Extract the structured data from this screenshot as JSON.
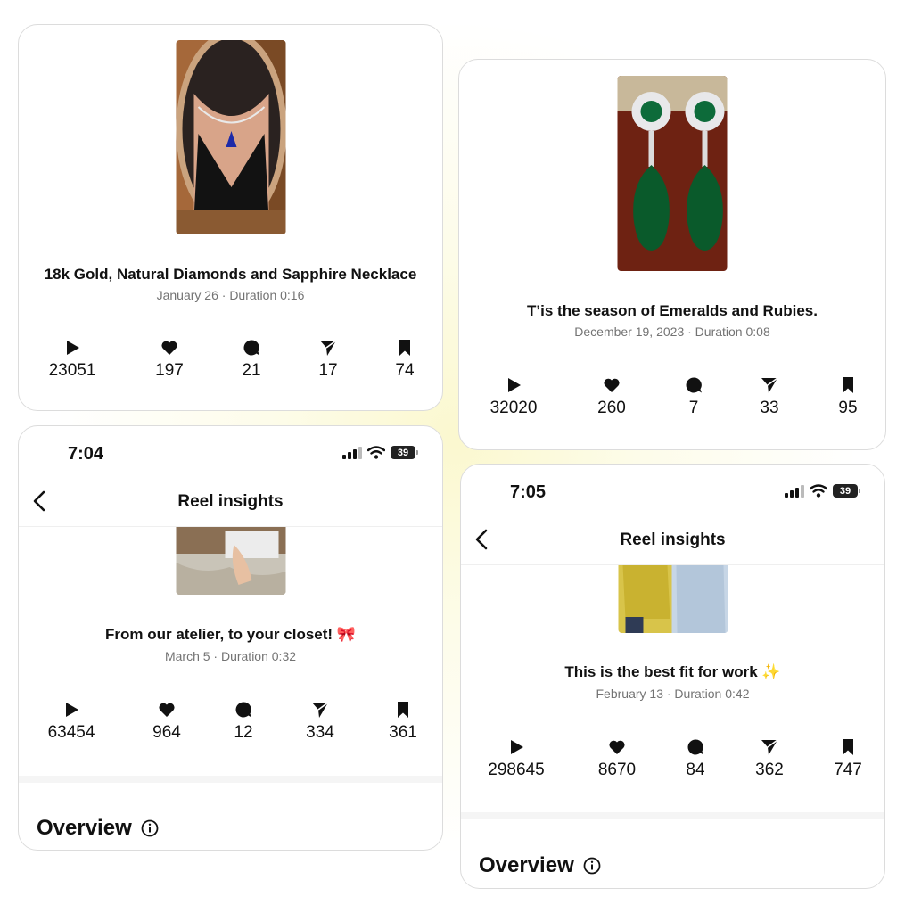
{
  "stat_icons": [
    "play-icon",
    "heart-icon",
    "comment-icon",
    "share-icon",
    "save-icon"
  ],
  "reels": [
    {
      "title": "18k Gold, Natural Diamonds and Sapphire Necklace",
      "meta": "January 26 · Duration 0:16",
      "stats": [
        "23051",
        "197",
        "21",
        "17",
        "74"
      ]
    },
    {
      "title": "T’is the season of Emeralds and Rubies.",
      "meta": "December 19, 2023 · Duration 0:08",
      "stats": [
        "32020",
        "260",
        "7",
        "33",
        "95"
      ]
    },
    {
      "status_time": "7:04",
      "battery": "39",
      "header_title": "Reel insights",
      "title": "From our atelier, to your closet! 🎀",
      "meta": "March 5 · Duration 0:32",
      "stats": [
        "63454",
        "964",
        "12",
        "334",
        "361"
      ],
      "section_title": "Overview"
    },
    {
      "status_time": "7:05",
      "battery": "39",
      "header_title": "Reel insights",
      "title": "This is the best fit for work ✨",
      "meta": "February 13 · Duration 0:42",
      "stats": [
        "298645",
        "8670",
        "84",
        "362",
        "747"
      ],
      "section_title": "Overview"
    }
  ]
}
